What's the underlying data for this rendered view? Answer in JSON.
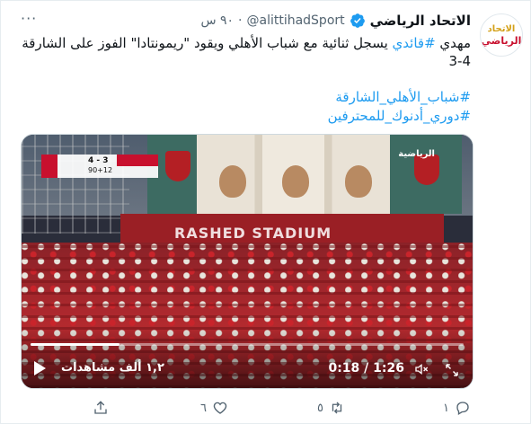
{
  "account": {
    "display_name": "الاتحاد الرياضي",
    "handle": "@alittihadSport",
    "separator": "·",
    "time": "٩٠ س",
    "avatar_line1": "الاتحاد",
    "avatar_line2": "الرياضي",
    "verified_icon": "verified-badge-icon"
  },
  "tweet": {
    "line1_prefix": "مهدي ",
    "line1_hashtag": "#قائدي",
    "line1_rest": " يسجل ثنائية مع شباب الأهلي ويقود \"ريمونتادا\" الفوز على الشارقة",
    "line2": "3-4",
    "hashtags": [
      "#شباب_الأهلي_الشارقة",
      "#دوري_أدنوك_للمحترفين"
    ]
  },
  "video": {
    "views": "١,٢ ألف مشاهدات",
    "elapsed": "0:18",
    "duration": "1:26",
    "time_separator": " / ",
    "progress_fraction": 0.206,
    "scoreboard_score": "4 - 3",
    "scoreboard_clock": "90+12",
    "channel_logo": "الرياضية",
    "banner_text": "RASHED STADIUM"
  },
  "actions": {
    "reply_count": "١",
    "retweet_count": "٥",
    "like_count": "٦"
  },
  "colors": {
    "accent": "#1d9bf0",
    "muted": "#536471",
    "verified": "#1d9bf0"
  }
}
